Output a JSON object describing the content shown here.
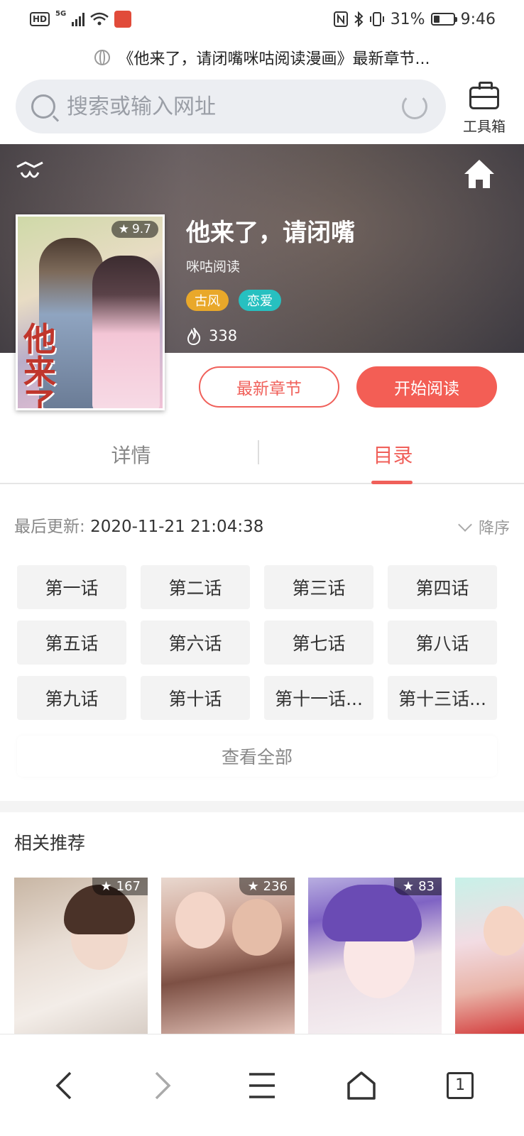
{
  "status_bar": {
    "hd_label": "HD",
    "network_label": "5G",
    "battery_percent": "31%",
    "time": "9:46"
  },
  "page_title": "《他来了，请闭嘴咪咕阅读漫画》最新章节...",
  "search": {
    "placeholder": "搜索或输入网址"
  },
  "toolbox_label": "工具箱",
  "comic": {
    "title": "他来了，请闭嘴",
    "source": "咪咕阅读",
    "rating": "9.7",
    "tags": [
      "古风",
      "恋爱"
    ],
    "heat": "338",
    "cover_title": "他来了"
  },
  "actions": {
    "latest_label": "最新章节",
    "read_label": "开始阅读"
  },
  "tabs": [
    {
      "label": "详情",
      "active": false
    },
    {
      "label": "目录",
      "active": true
    }
  ],
  "catalog": {
    "update_prefix": "最后更新:",
    "update_time": "2020-11-21 21:04:38",
    "order_label": "降序",
    "chapters": [
      "第一话",
      "第二话",
      "第三话",
      "第四话",
      "第五话",
      "第六话",
      "第七话",
      "第八话",
      "第九话",
      "第十话",
      "第十一话...",
      "第十三话..."
    ],
    "view_all_label": "查看全部"
  },
  "recommend": {
    "title": "相关推荐",
    "items": [
      {
        "score": "167"
      },
      {
        "score": "236"
      },
      {
        "score": "83"
      },
      {
        "score": ""
      }
    ]
  },
  "bottom_nav": {
    "tab_count": "1"
  },
  "colors": {
    "accent": "#f0605a",
    "tag_gufeng": "#e9a82a",
    "tag_lianai": "#27c0c0"
  }
}
